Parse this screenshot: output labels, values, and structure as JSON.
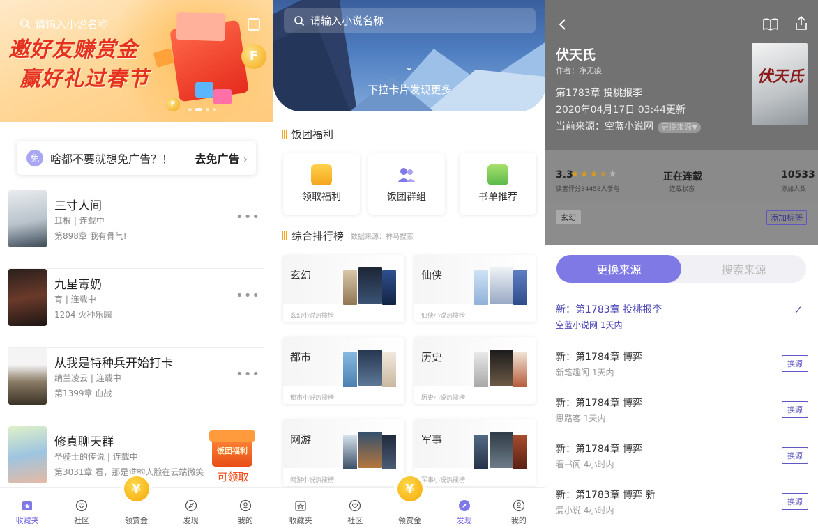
{
  "bookshelf": {
    "search_placeholder": "请输入小说名称",
    "banner_line1": "邀好友赚赏金",
    "banner_line2": "赢好礼过春节",
    "ad_badge": "免",
    "ad_text": "啥都不要就想免广告？！",
    "ad_button": "去免广告",
    "books": [
      {
        "title": "三寸人间",
        "author": "耳根",
        "status": "连载中",
        "last": "第898章 我有骨气!"
      },
      {
        "title": "九星毒奶",
        "author": "育",
        "status": "连载中",
        "last": "1204 火种乐园"
      },
      {
        "title": "从我是特种兵开始打卡",
        "author": "纳兰凌云",
        "status": "连载中",
        "last": "第1399章 血战"
      },
      {
        "title": "修真聊天群",
        "author": "圣骑士的传说",
        "status": "连载中",
        "last": "第3031章 看，那是谁的人脸在云端微笑"
      }
    ],
    "fuli_tag": "饭团福利",
    "fuli_cta": "可领取",
    "tabs": [
      "收藏夹",
      "社区",
      "领赏金",
      "发现",
      "我的"
    ],
    "mid_symbol": "¥"
  },
  "discover": {
    "search_placeholder": "请输入小说名称",
    "pull_hint": "下拉卡片发现更多",
    "welfare_header": "饭团福利",
    "welfare_cards": [
      "领取福利",
      "饭团群组",
      "书单推荐"
    ],
    "rank_header": "综合排行榜",
    "rank_source": "数据来源：神马搜索",
    "ranks": [
      {
        "name": "玄幻",
        "sub": "玄幻小说热搜榜"
      },
      {
        "name": "仙侠",
        "sub": "仙侠小说热搜榜"
      },
      {
        "name": "都市",
        "sub": "都市小说热搜榜"
      },
      {
        "name": "历史",
        "sub": "历史小说热搜榜"
      },
      {
        "name": "网游",
        "sub": "网游小说热搜榜"
      },
      {
        "name": "军事",
        "sub": "军事小说热搜榜"
      }
    ],
    "tabs": [
      "收藏夹",
      "社区",
      "领赏金",
      "发现",
      "我的"
    ],
    "mid_symbol": "¥"
  },
  "detail": {
    "title": "伏天氏",
    "author": "作者：净无痕",
    "chapter": "第1783章 投桃报李",
    "updated": "2020年04月17日 03:44更新",
    "source_label": "当前来源：空蓝小说网",
    "source_chip": "更换来源▼",
    "cover_text": "伏天氏",
    "rating": "3.3",
    "rating_label": "读者评分34458人参与",
    "status": "正在连载",
    "status_label": "连载状态",
    "adds": "10533",
    "adds_label": "添加人数",
    "genre_tag": "玄幻",
    "add_tag": "添加标签",
    "seg_active": "更换来源",
    "seg_inactive": "搜索来源",
    "sources": [
      {
        "chapter": "新：第1783章 投桃报李",
        "meta": "空蓝小说网 1天内",
        "current": true
      },
      {
        "chapter": "新：第1784章 博弈",
        "meta": "新笔趣阁 1天内",
        "action": "换源"
      },
      {
        "chapter": "新：第1784章 博弈",
        "meta": "思路客 1天内",
        "action": "换源"
      },
      {
        "chapter": "新：第1784章 博弈",
        "meta": "看书阁 4小时内",
        "action": "换源"
      },
      {
        "chapter": "新：第1783章 博弈 新",
        "meta": "爱小说 4小时内",
        "action": "换源"
      }
    ],
    "check": "✓"
  }
}
